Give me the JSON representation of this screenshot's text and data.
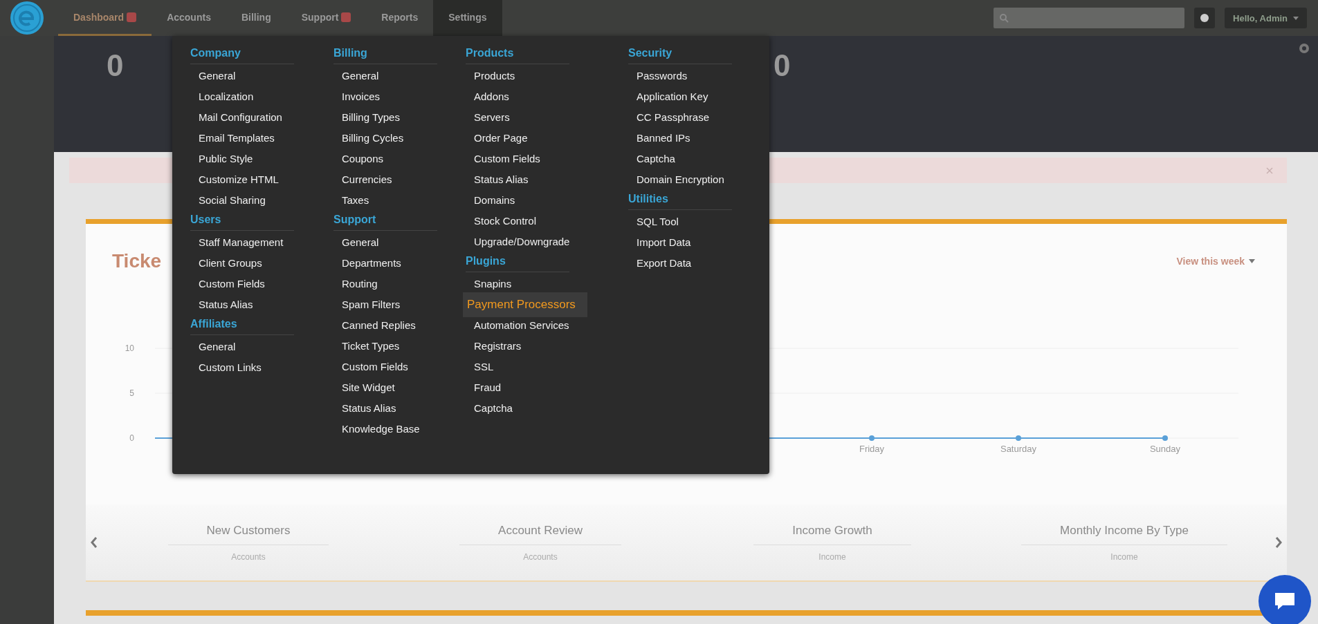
{
  "nav": {
    "tabs": [
      {
        "label": "Dashboard",
        "selected": true,
        "expanded": false,
        "badge": true
      },
      {
        "label": "Accounts",
        "selected": false,
        "expanded": false,
        "badge": false
      },
      {
        "label": "Billing",
        "selected": false,
        "expanded": false,
        "badge": false
      },
      {
        "label": "Support",
        "selected": false,
        "expanded": false,
        "badge": true
      },
      {
        "label": "Reports",
        "selected": false,
        "expanded": false,
        "badge": false
      },
      {
        "label": "Settings",
        "selected": false,
        "expanded": true,
        "badge": false
      }
    ],
    "user_menu": "Hello, Admin"
  },
  "stats": [
    {
      "value": "0"
    },
    {
      "value": "0"
    }
  ],
  "ticket_card": {
    "title": "Ticke",
    "period_link": "View this week",
    "chart": {
      "y_labels": [
        "10",
        "5",
        "0"
      ],
      "x_labels": [
        "Friday",
        "Saturday",
        "Sunday"
      ]
    }
  },
  "carousel": [
    {
      "title": "New Customers",
      "subtitle": "Accounts"
    },
    {
      "title": "Account Review",
      "subtitle": "Accounts"
    },
    {
      "title": "Income Growth",
      "subtitle": "Income"
    },
    {
      "title": "Monthly Income By Type",
      "subtitle": "Income"
    }
  ],
  "settings_menu": {
    "columns": [
      {
        "sections": [
          {
            "heading": "Company",
            "items": [
              {
                "label": "General",
                "selected": false
              },
              {
                "label": "Localization",
                "selected": false
              },
              {
                "label": "Mail Configuration",
                "selected": false
              },
              {
                "label": "Email Templates",
                "selected": false
              },
              {
                "label": "Public Style",
                "selected": false
              },
              {
                "label": "Customize HTML",
                "selected": false
              },
              {
                "label": "Social Sharing",
                "selected": false
              }
            ]
          },
          {
            "heading": "Users",
            "items": [
              {
                "label": "Staff Management",
                "selected": false
              },
              {
                "label": "Client Groups",
                "selected": false
              },
              {
                "label": "Custom Fields",
                "selected": false
              },
              {
                "label": "Status Alias",
                "selected": false
              }
            ]
          },
          {
            "heading": "Affiliates",
            "items": [
              {
                "label": "General",
                "selected": false
              },
              {
                "label": "Custom Links",
                "selected": false
              }
            ]
          }
        ]
      },
      {
        "sections": [
          {
            "heading": "Billing",
            "items": [
              {
                "label": "General",
                "selected": false
              },
              {
                "label": "Invoices",
                "selected": false
              },
              {
                "label": "Billing Types",
                "selected": false
              },
              {
                "label": "Billing Cycles",
                "selected": false
              },
              {
                "label": "Coupons",
                "selected": false
              },
              {
                "label": "Currencies",
                "selected": false
              },
              {
                "label": "Taxes",
                "selected": false
              }
            ]
          },
          {
            "heading": "Support",
            "items": [
              {
                "label": "General",
                "selected": false
              },
              {
                "label": "Departments",
                "selected": false
              },
              {
                "label": "Routing",
                "selected": false
              },
              {
                "label": "Spam Filters",
                "selected": false
              },
              {
                "label": "Canned Replies",
                "selected": false
              },
              {
                "label": "Ticket Types",
                "selected": false
              },
              {
                "label": "Custom Fields",
                "selected": false
              },
              {
                "label": "Site Widget",
                "selected": false
              },
              {
                "label": "Status Alias",
                "selected": false
              },
              {
                "label": "Knowledge Base",
                "selected": false
              }
            ]
          }
        ]
      },
      {
        "sections": [
          {
            "heading": "Products",
            "items": [
              {
                "label": "Products",
                "selected": false
              },
              {
                "label": "Addons",
                "selected": false
              },
              {
                "label": "Servers",
                "selected": false
              },
              {
                "label": "Order Page",
                "selected": false
              },
              {
                "label": "Custom Fields",
                "selected": false
              },
              {
                "label": "Status Alias",
                "selected": false
              },
              {
                "label": "Domains",
                "selected": false
              },
              {
                "label": "Stock Control",
                "selected": false
              },
              {
                "label": "Upgrade/Downgrade",
                "selected": false
              }
            ]
          },
          {
            "heading": "Plugins",
            "items": [
              {
                "label": "Snapins",
                "selected": false
              },
              {
                "label": "Payment Processors",
                "selected": true
              },
              {
                "label": "Automation Services",
                "selected": false
              },
              {
                "label": "Registrars",
                "selected": false
              },
              {
                "label": "SSL",
                "selected": false
              },
              {
                "label": "Fraud",
                "selected": false
              },
              {
                "label": "Captcha",
                "selected": false
              }
            ]
          }
        ]
      },
      {
        "sections": [
          {
            "heading": "Security",
            "items": [
              {
                "label": "Passwords",
                "selected": false
              },
              {
                "label": "Application Key",
                "selected": false
              },
              {
                "label": "CC Passphrase",
                "selected": false
              },
              {
                "label": "Banned IPs",
                "selected": false
              },
              {
                "label": "Captcha",
                "selected": false
              },
              {
                "label": "Domain Encryption",
                "selected": false
              }
            ]
          },
          {
            "heading": "Utilities",
            "items": [
              {
                "label": "SQL Tool",
                "selected": false
              },
              {
                "label": "Import Data",
                "selected": false
              },
              {
                "label": "Export Data",
                "selected": false
              }
            ]
          }
        ]
      }
    ]
  }
}
